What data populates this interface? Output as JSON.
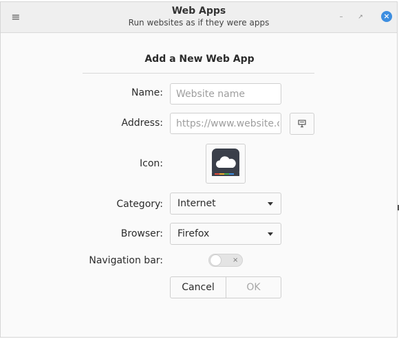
{
  "window": {
    "title": "Web Apps",
    "subtitle": "Run websites as if they were apps",
    "menu_icon": "hamburger-menu-icon",
    "accent_color": "#3d8ee0"
  },
  "dialog": {
    "heading": "Add a New Web App",
    "name": {
      "label": "Name:",
      "placeholder": "Website name",
      "value": ""
    },
    "address": {
      "label": "Address:",
      "placeholder": "https://www.website.com",
      "favicon_button_icon": "download-favicon-icon"
    },
    "icon": {
      "label": "Icon:",
      "image": "cloud-app-icon"
    },
    "category": {
      "label": "Category:",
      "selected": "Internet"
    },
    "browser": {
      "label": "Browser:",
      "selected": "Firefox"
    },
    "navigation_bar": {
      "label": "Navigation bar:",
      "enabled": false
    },
    "buttons": {
      "cancel": "Cancel",
      "ok": "OK"
    }
  }
}
